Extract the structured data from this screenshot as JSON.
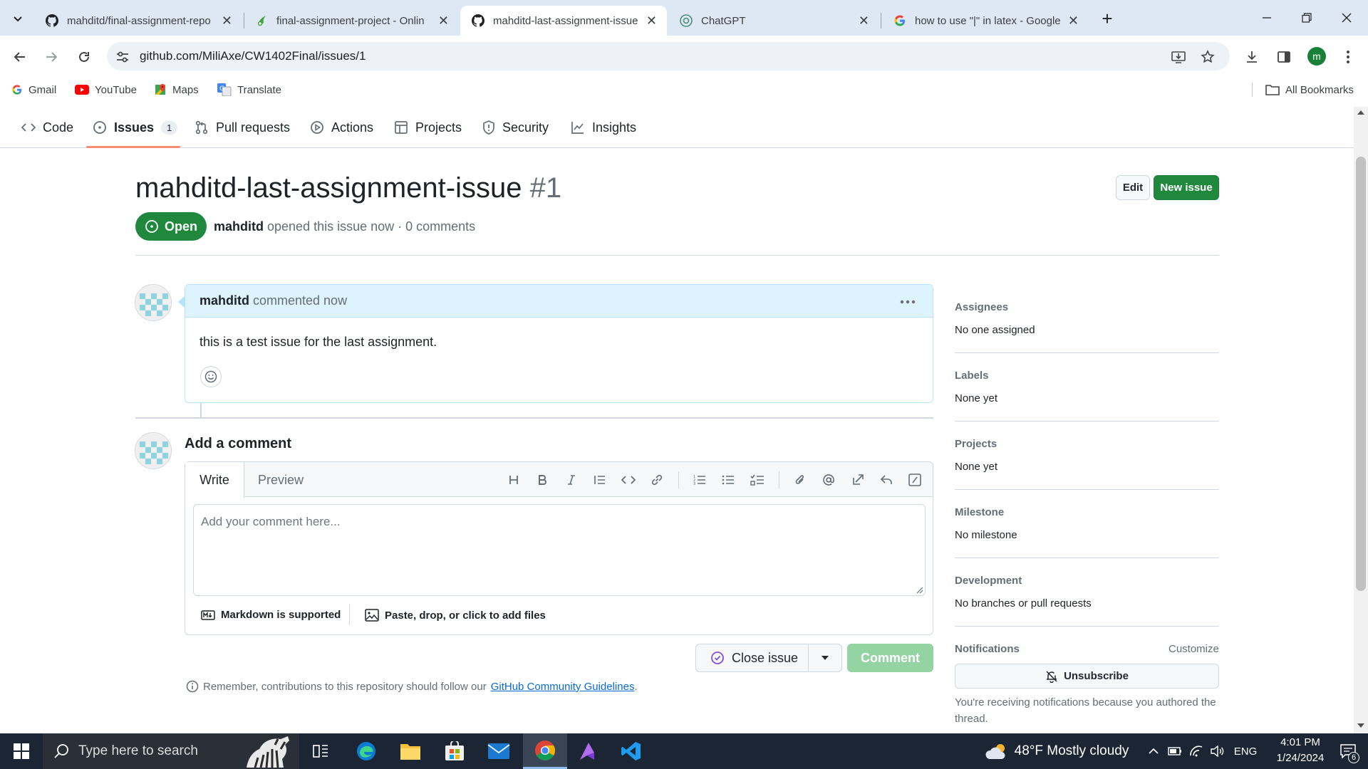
{
  "browser": {
    "tabs": [
      {
        "title": "mahditd/final-assignment-repo",
        "icon": "github-icon"
      },
      {
        "title": "final-assignment-project - Onlin",
        "icon": "overleaf-icon"
      },
      {
        "title": "mahditd-last-assignment-issue",
        "icon": "github-icon",
        "active": true
      },
      {
        "title": "ChatGPT",
        "icon": "chatgpt-icon"
      },
      {
        "title": "how to use \"|\" in latex - Google",
        "icon": "google-icon"
      }
    ],
    "url": "github.com/MiliAxe/CW1402Final/issues/1",
    "profile_initial": "m",
    "bookmarks": [
      "Gmail",
      "YouTube",
      "Maps",
      "Translate"
    ],
    "all_bookmarks": "All Bookmarks"
  },
  "repo_nav": {
    "items": [
      {
        "label": "Code",
        "icon": "code-icon"
      },
      {
        "label": "Issues",
        "icon": "issue-opened-icon",
        "count": "1",
        "selected": true
      },
      {
        "label": "Pull requests",
        "icon": "pull-request-icon"
      },
      {
        "label": "Actions",
        "icon": "play-icon"
      },
      {
        "label": "Projects",
        "icon": "table-icon"
      },
      {
        "label": "Security",
        "icon": "shield-icon"
      },
      {
        "label": "Insights",
        "icon": "graph-icon"
      }
    ]
  },
  "issue": {
    "title": "mahditd-last-assignment-issue",
    "number": "#1",
    "edit_label": "Edit",
    "new_issue_label": "New issue",
    "state": "Open",
    "author": "mahditd",
    "meta_rest": "opened this issue now · 0 comments"
  },
  "comment": {
    "author": "mahditd",
    "time": "commented now",
    "body": "this is a test issue for the last assignment."
  },
  "add_comment": {
    "heading": "Add a comment",
    "tab_write": "Write",
    "tab_preview": "Preview",
    "placeholder": "Add your comment here...",
    "markdown_note": "Markdown is supported",
    "files_note": "Paste, drop, or click to add files",
    "close_label": "Close issue",
    "comment_label": "Comment",
    "guidelines_prefix": "Remember, contributions to this repository should follow our",
    "guidelines_link": "GitHub Community Guidelines",
    "guidelines_suffix": "."
  },
  "sidebar": {
    "assignees": {
      "heading": "Assignees",
      "value": "No one assigned"
    },
    "labels": {
      "heading": "Labels",
      "value": "None yet"
    },
    "projects": {
      "heading": "Projects",
      "value": "None yet"
    },
    "milestone": {
      "heading": "Milestone",
      "value": "No milestone"
    },
    "development": {
      "heading": "Development",
      "value": "No branches or pull requests"
    },
    "notifications": {
      "heading": "Notifications",
      "customize": "Customize",
      "unsubscribe": "Unsubscribe",
      "note": "You're receiving notifications because you authored the thread."
    }
  },
  "taskbar": {
    "search_placeholder": "Type here to search",
    "weather": "48°F  Mostly cloudy",
    "language": "ENG",
    "time": "4:01 PM",
    "date": "1/24/2024",
    "notif_count": "6"
  },
  "colors": {
    "accent_green": "#1f883d",
    "link_blue": "#0969da",
    "comment_header": "#ddf4ff",
    "nav_underline": "#fd8c73"
  }
}
